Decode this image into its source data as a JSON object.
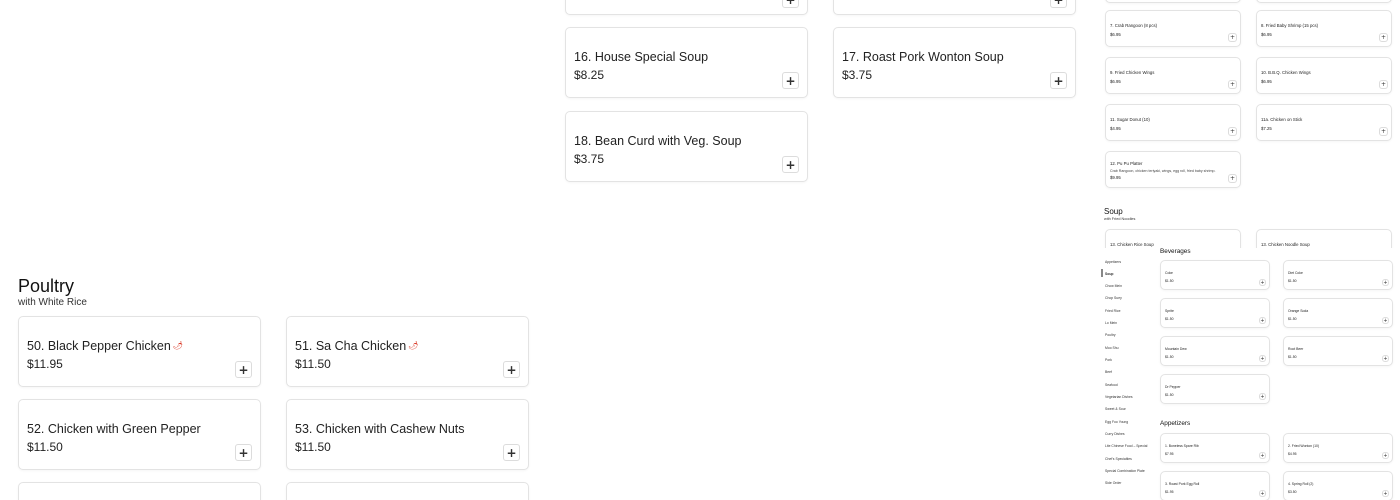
{
  "main": {
    "soup_cards": [
      {
        "title": "16. House Special Soup",
        "price": "$8.25"
      },
      {
        "title": "17. Roast Pork Wonton Soup",
        "price": "$3.75"
      },
      {
        "title": "18. Bean Curd with Veg. Soup",
        "price": "$3.75"
      }
    ],
    "poultry": {
      "title": "Poultry",
      "subtitle": "with White Rice",
      "items": [
        {
          "title": "50. Black Pepper Chicken",
          "price": "$11.95",
          "spicy": true
        },
        {
          "title": "51. Sa Cha Chicken",
          "price": "$11.50",
          "spicy": true
        },
        {
          "title": "52. Chicken with Green Pepper",
          "price": "$11.50",
          "spicy": false
        },
        {
          "title": "53. Chicken with Cashew Nuts",
          "price": "$11.50",
          "spicy": false
        }
      ]
    },
    "add_symbol": "+",
    "chili_symbol": "🌶"
  },
  "preview": {
    "appetizers": [
      {
        "title": "7. Crab Rangoon (8 pcs)",
        "price": "$6.95"
      },
      {
        "title": "8. Fried Baby Shrimp (15 pcs)",
        "price": "$6.95"
      },
      {
        "title": "9. Fried Chicken Wings",
        "price": "$6.95"
      },
      {
        "title": "10. B.B.Q. Chicken Wings",
        "price": "$6.95"
      },
      {
        "title": "11. Sugar Donut (10)",
        "price": "$4.95"
      },
      {
        "title": "11a. Chicken on Stick",
        "price": "$7.25"
      },
      {
        "title": "12. Pu Pu Platter",
        "description": "Crab Rangoon, chicken teriyaki, wings, egg roll, fried baby shrimp.",
        "price": "$9.95"
      }
    ],
    "soup_section": {
      "title": "Soup",
      "subtitle": "with Fried Noodles"
    },
    "soup_cards": [
      {
        "title": "13. Chicken Rice Soup"
      },
      {
        "title": "13. Chicken Noodle Soup"
      }
    ]
  },
  "tiny": {
    "nav": [
      "Appetizers",
      "Soup",
      "Chow Mein",
      "Chop Suey",
      "Fried Rice",
      "Lo Mein",
      "Poultry",
      "Moo Shu",
      "Pork",
      "Beef",
      "Seafood",
      "Vegetarian Dishes",
      "Sweet & Sour",
      "Egg Foo Young",
      "Curry Dishes",
      "Lite Chinese Food – Special",
      "Chef's Specialties",
      "Special Combination Plate",
      "Side Order"
    ],
    "nav_active": 1,
    "beverages": {
      "title": "Beverages",
      "items": [
        {
          "title": "Coke",
          "price": "$1.50"
        },
        {
          "title": "Diet Coke",
          "price": "$1.50"
        },
        {
          "title": "Sprite",
          "price": "$1.50"
        },
        {
          "title": "Orange Soda",
          "price": "$1.50"
        },
        {
          "title": "Mountain Dew",
          "price": "$1.50"
        },
        {
          "title": "Root Beer",
          "price": "$1.50"
        },
        {
          "title": "Dr Pepper",
          "price": "$1.50"
        }
      ]
    },
    "appetizers": {
      "title": "Appetizers",
      "items": [
        {
          "title": "1. Boneless Spare Rib",
          "price": "$7.95"
        },
        {
          "title": "2. Fried Wonton (10)",
          "price": "$4.95"
        },
        {
          "title": "3. Roast Pork Egg Roll",
          "price": "$1.95"
        },
        {
          "title": "4. Spring Roll (2)",
          "price": "$3.50"
        }
      ]
    }
  }
}
